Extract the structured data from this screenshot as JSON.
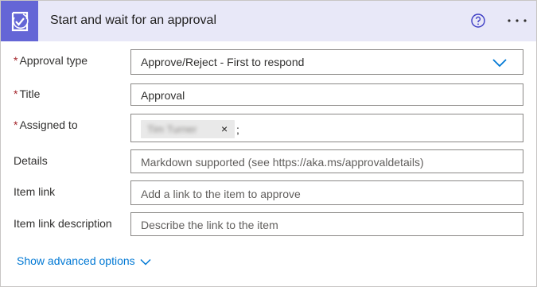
{
  "header": {
    "title": "Start and wait for an approval",
    "icon": "approval-icon",
    "accent": "#6466d6",
    "background": "#e8e8f8"
  },
  "fields": {
    "approval_type": {
      "label": "Approval type",
      "required": "*",
      "value": "Approve/Reject - First to respond"
    },
    "title": {
      "label": "Title",
      "required": "*",
      "value": "Approval"
    },
    "assigned_to": {
      "label": "Assigned to",
      "required": "*",
      "chip_name": "Tim Turner",
      "chip_remove": "×",
      "separator": ";"
    },
    "details": {
      "label": "Details",
      "placeholder": "Markdown supported (see https://aka.ms/approvaldetails)"
    },
    "item_link": {
      "label": "Item link",
      "placeholder": "Add a link to the item to approve"
    },
    "item_link_description": {
      "label": "Item link description",
      "placeholder": "Describe the link to the item"
    }
  },
  "advanced": {
    "label": "Show advanced options"
  }
}
